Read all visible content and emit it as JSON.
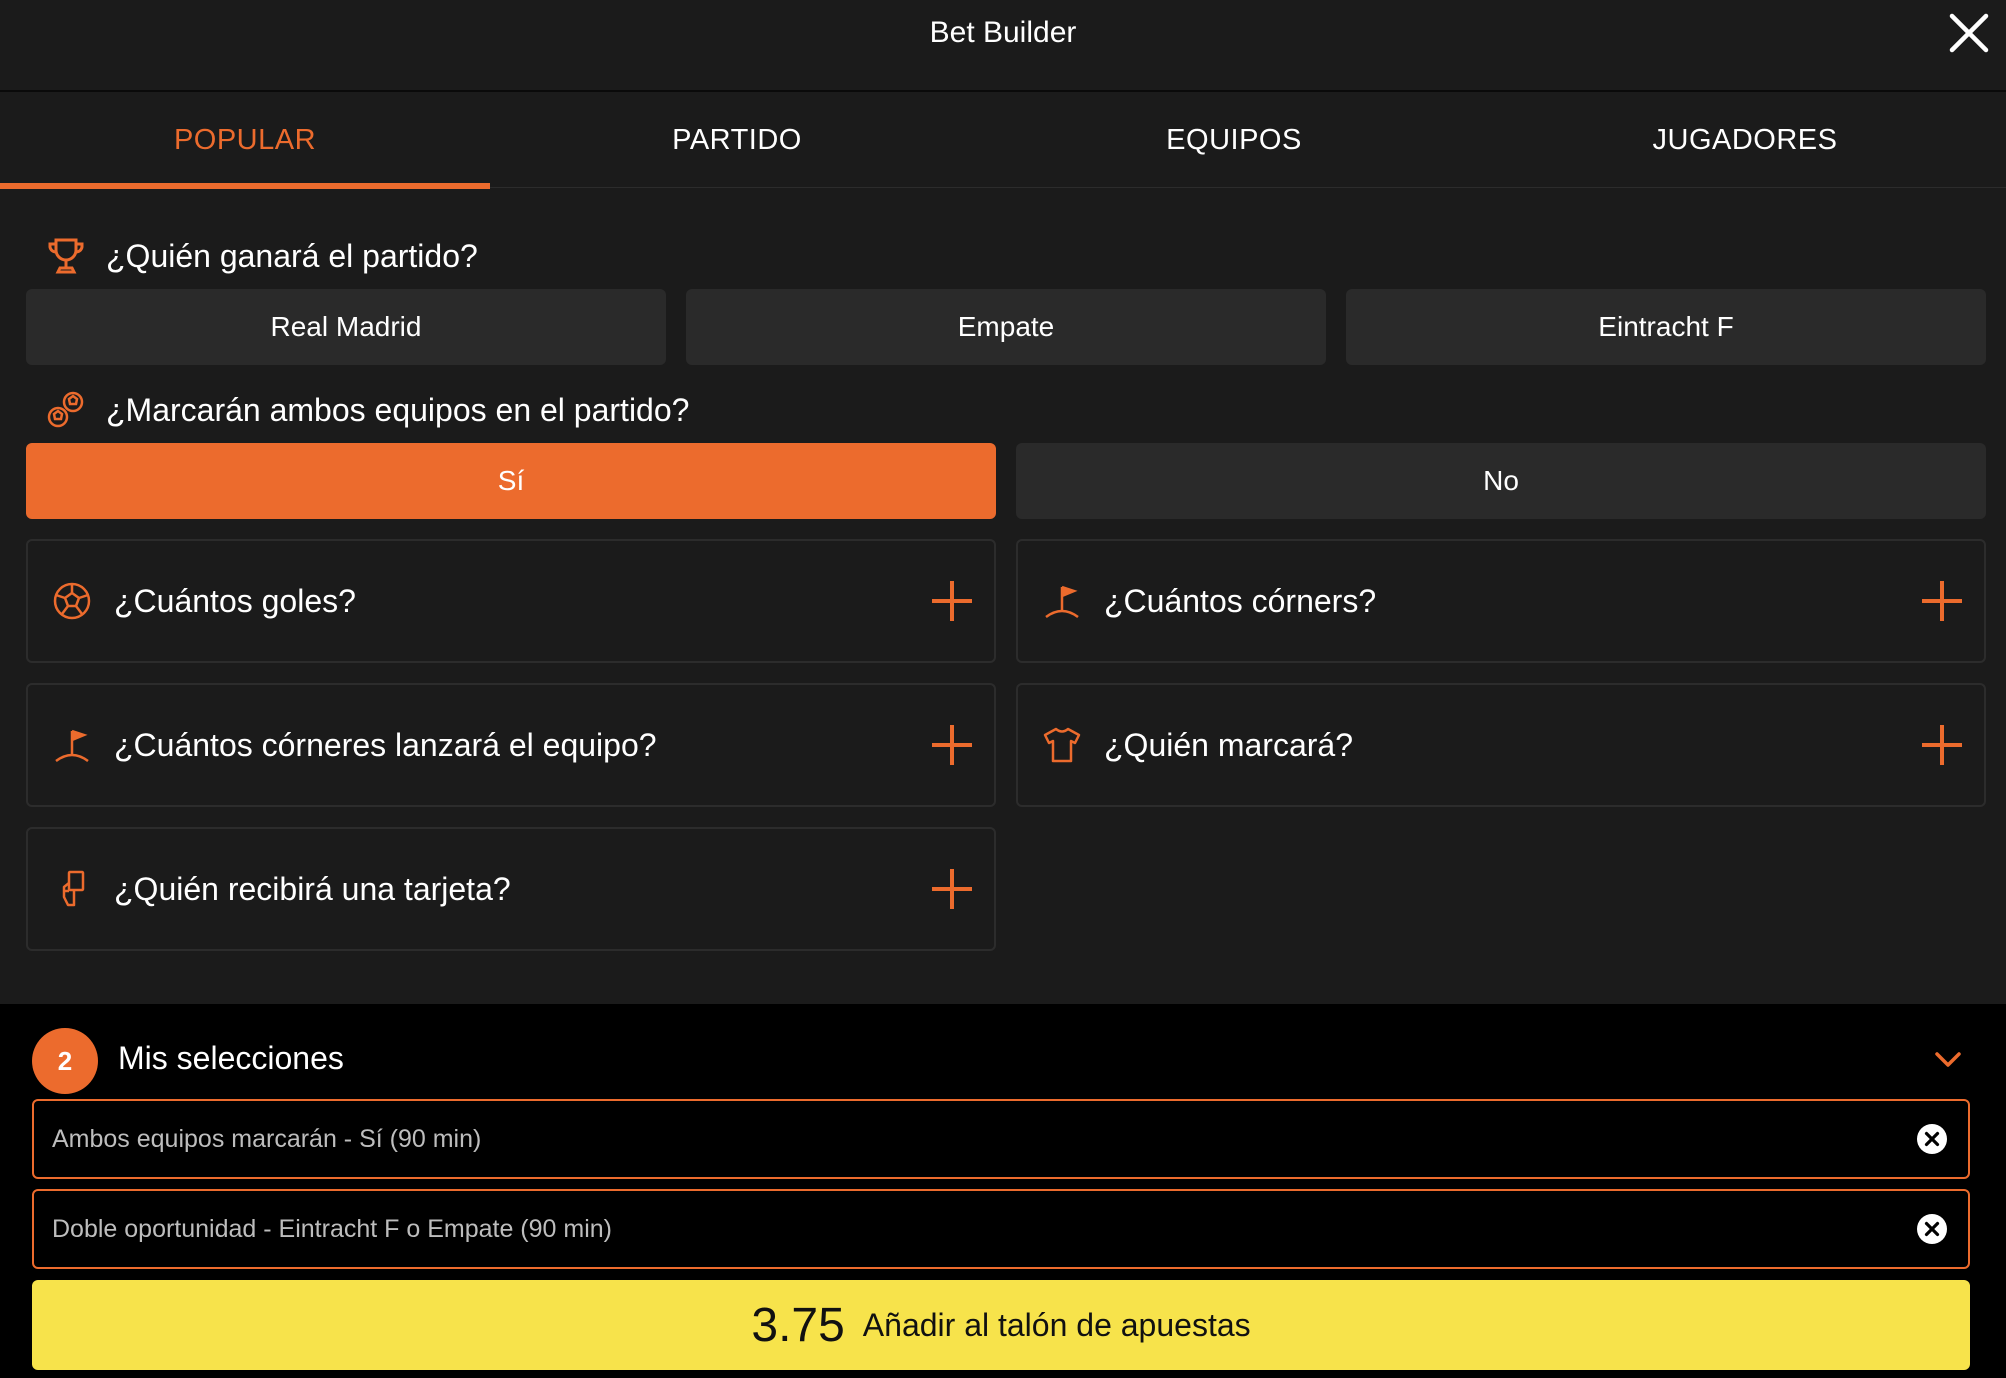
{
  "header": {
    "title": "Bet Builder",
    "close_icon": "close-icon"
  },
  "tabs": [
    {
      "label": "POPULAR",
      "active": true
    },
    {
      "label": "PARTIDO",
      "active": false
    },
    {
      "label": "EQUIPOS",
      "active": false
    },
    {
      "label": "JUGADORES",
      "active": false
    }
  ],
  "winner": {
    "question": "¿Quién ganará el partido?",
    "icon": "trophy-icon",
    "options": [
      "Real Madrid",
      "Empate",
      "Eintracht F"
    ]
  },
  "btts": {
    "question": "¿Marcarán ambos equipos en el partido?",
    "icon": "balls-icon",
    "options": [
      "Sí",
      "No"
    ],
    "selected": "Sí"
  },
  "markets": [
    {
      "label": "¿Cuántos goles?",
      "icon": "football-icon"
    },
    {
      "label": "¿Cuántos córners?",
      "icon": "corner-flag-icon"
    },
    {
      "label": "¿Cuántos córneres lanzará el equipo?",
      "icon": "corner-flag-icon"
    },
    {
      "label": "¿Quién marcará?",
      "icon": "shirt-icon"
    },
    {
      "label": "¿Quién recibirá una tarjeta?",
      "icon": "card-icon"
    }
  ],
  "selections": {
    "count": "2",
    "title": "Mis selecciones",
    "items": [
      "Ambos equipos marcarán - Sí (90 min)",
      "Doble oportunidad - Eintracht F o Empate (90 min)"
    ]
  },
  "cta": {
    "odds": "3.75",
    "label": "Añadir al talón de apuestas"
  },
  "colors": {
    "accent": "#ec6b2d",
    "cta": "#f7e34b",
    "background": "#1b1b1b",
    "panel": "#000000"
  }
}
